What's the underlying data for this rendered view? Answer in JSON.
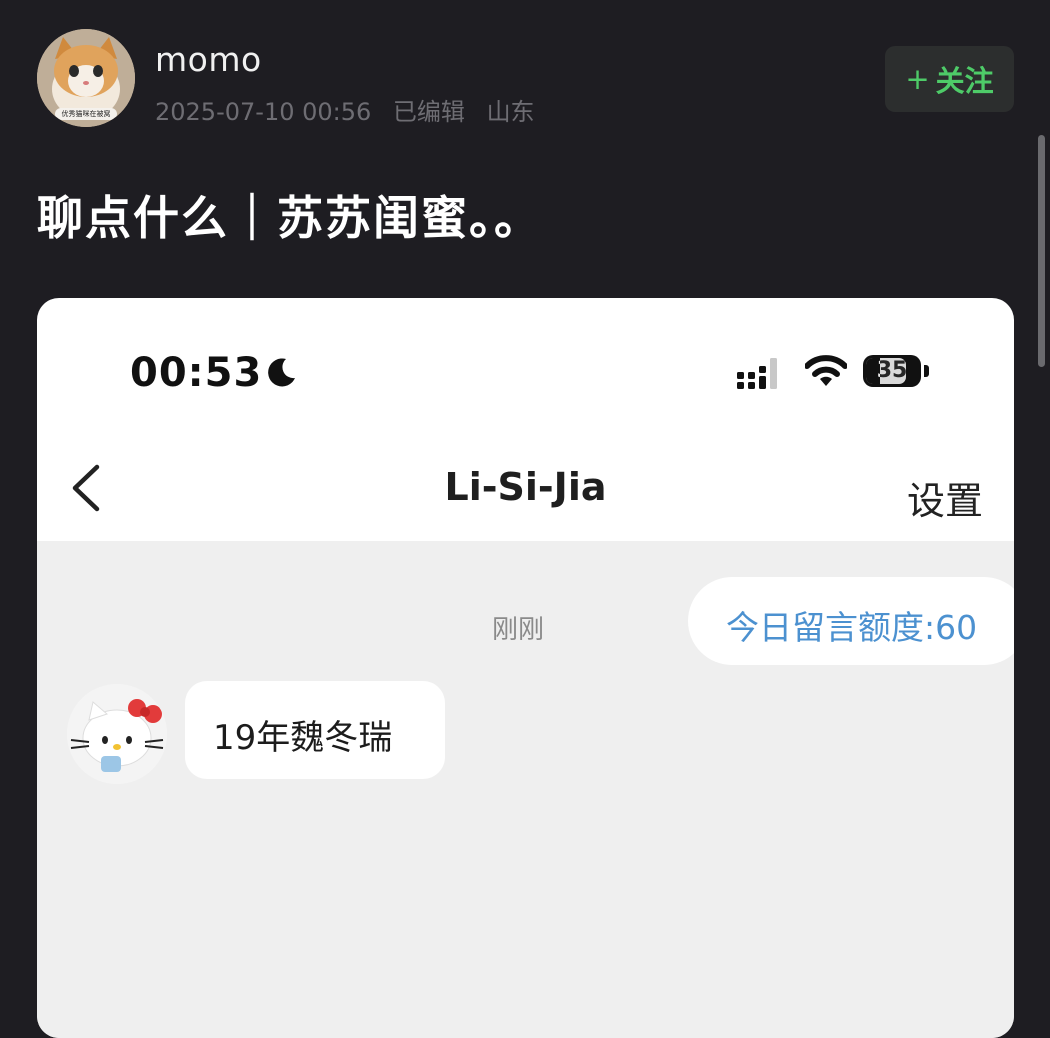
{
  "post": {
    "username": "momo",
    "avatar_caption": "优秀猫咪在被窝",
    "date": "2025-07-10 00:56",
    "edited": "已编辑",
    "location": "山东",
    "follow_plus": "+",
    "follow_label": "关注",
    "title": "聊点什么｜苏苏闺蜜。。"
  },
  "screenshot": {
    "status_bar": {
      "time": "00:53",
      "battery_level": "35"
    },
    "nav": {
      "title": "Li-Si-Jia",
      "settings": "设置"
    },
    "chat": {
      "time_label": "刚刚",
      "quota_text": "今日留言额度:60",
      "message": "19年魏冬瑞"
    }
  },
  "colors": {
    "background": "#1e1d22",
    "follow_green": "#4ecb68",
    "quota_blue": "#4c91d0"
  },
  "icons": [
    "moon-icon",
    "cellular-signal-icon",
    "wifi-icon",
    "battery-icon",
    "back-chevron-icon"
  ]
}
